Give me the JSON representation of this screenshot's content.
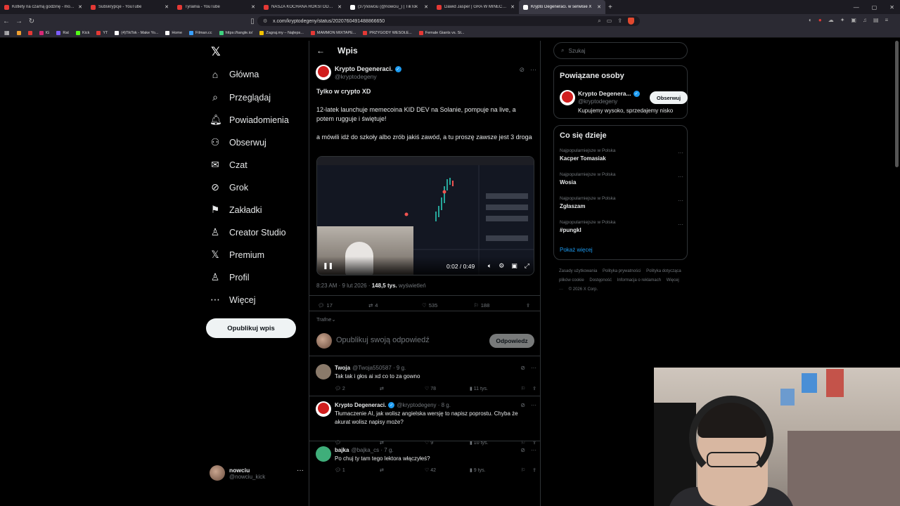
{
  "browser": {
    "tabs": [
      {
        "title": "Kotlety na czarną godzinę - mogą st...",
        "color": "#e53935"
      },
      {
        "title": "Subskrypcje - YouTube",
        "color": "#e53935"
      },
      {
        "title": "Tyrainia - YouTube",
        "color": "#e53935"
      },
      {
        "title": "NASZA KOCHANA ROKSI ODESZŁA",
        "color": "#e53935"
      },
      {
        "title": "(37)nowciu (@nowciu_) | TikTok",
        "color": "#ffffff"
      },
      {
        "title": "Dawid Jasper | GRA W MINECRAFT -",
        "color": "#e53935"
      },
      {
        "title": "Krypto Degeneraci. w serwisie X",
        "color": "#ffffff",
        "active": true
      }
    ],
    "new_tab": "+",
    "url": "x.com/kryptodegeny/status/2020760491488866650",
    "bookmarks": [
      {
        "label": "",
        "color": "#f0a030"
      },
      {
        "label": "",
        "color": "#e53935"
      },
      {
        "label": "IG",
        "color": "#d62976"
      },
      {
        "label": "Rat",
        "color": "#7c5cff"
      },
      {
        "label": "Kick",
        "color": "#53fc18"
      },
      {
        "label": "YT",
        "color": "#e53935"
      },
      {
        "label": "(4)TikTok - Make Yo...",
        "color": "#ffffff"
      },
      {
        "label": "Home",
        "color": "#ffffff"
      },
      {
        "label": "Filman.cc",
        "color": "#3aa0ff"
      },
      {
        "label": "https://tangle.io/",
        "color": "#3fd27f"
      },
      {
        "label": "Zagraj.my – Najleps...",
        "color": "#f2c200"
      },
      {
        "label": "MAMMON MIXTAPE...",
        "color": "#e53935"
      },
      {
        "label": "PRZYGODY WESOŁE...",
        "color": "#e53935"
      },
      {
        "label": "Female Giants vs. St...",
        "color": "#e53935"
      }
    ]
  },
  "nav": {
    "items": [
      {
        "label": "Główna",
        "icon": "⌂",
        "name": "home"
      },
      {
        "label": "Przeglądaj",
        "icon": "⌕",
        "name": "explore"
      },
      {
        "label": "Powiadomienia",
        "icon": "🔔︎",
        "name": "notifications"
      },
      {
        "label": "Obserwuj",
        "icon": "⚇",
        "name": "follow"
      },
      {
        "label": "Czat",
        "icon": "✉",
        "name": "chat"
      },
      {
        "label": "Grok",
        "icon": "⊘",
        "name": "grok"
      },
      {
        "label": "Zakładki",
        "icon": "⚑",
        "name": "bookmarks"
      },
      {
        "label": "Creator Studio",
        "icon": "♙",
        "name": "creator-studio"
      },
      {
        "label": "Premium",
        "icon": "𝕏",
        "name": "premium"
      },
      {
        "label": "Profil",
        "icon": "♙",
        "name": "profile"
      },
      {
        "label": "Więcej",
        "icon": "⋯",
        "name": "more"
      }
    ],
    "post_button": "Opublikuj wpis",
    "user": {
      "name": "nowciu",
      "handle": "@nowciu_kick"
    }
  },
  "post": {
    "header": "Wpis",
    "author": "Krypto Degeneraci.",
    "handle": "@kryptodegeny",
    "title": "Tylko w crypto XD",
    "para1": "12-latek launchuje memecoina KID DEV na Solanie, pompuje na live, a potem rugguje i świętuje!",
    "para2": "a mówili idź do szkoły albo zrób jakiś zawód, a tu proszę zawsze jest 3 droga",
    "video_time": "0:02 / 0:49",
    "video_progress": 0.04,
    "timestamp": "8:23 AM · 9 lut 2026 · ",
    "views": "148,5 tys.",
    "views_label": " wyświetleń",
    "replies": "17",
    "reposts": "4",
    "likes": "535",
    "bookmarks": "188",
    "sort": "Trafne",
    "reply_placeholder": "Opublikuj swoją odpowiedź",
    "reply_button": "Odpowiedz"
  },
  "replies": [
    {
      "name": "Twoja",
      "handle": "@Twoja550587 · 9 g.",
      "text": "Tak tak i głos ai xd co to za gowno",
      "replies": "2",
      "reposts": "",
      "likes": "78",
      "views": "11 tys.",
      "avatar": "#8a7a6a",
      "verified": false
    },
    {
      "name": "Krypto Degeneraci.",
      "handle": "@kryptodegeny · 8 g.",
      "text": "Tłumaczenie AI,  jak wolisz angielska wersję to napisz poprostu.  Chyba że akurat wolisz napisy może?",
      "replies": "",
      "reposts": "",
      "likes": "9",
      "views": "10 tys.",
      "avatar": "#d11e1e",
      "verified": true
    },
    {
      "name": "bajka",
      "handle": "@bajka_cs · 7 g.",
      "text": "Po chuj ty tam tego lektora włączyłeś?",
      "replies": "1",
      "reposts": "",
      "likes": "42",
      "views": "9 tys.",
      "avatar": "#3fae7a",
      "verified": false
    }
  ],
  "sidebar": {
    "search_placeholder": "Szukaj",
    "people_title": "Powiązane osoby",
    "person": {
      "name": "Krypto Degenera...",
      "handle": "@kryptodegeny",
      "bio": "Kupujemy wysoko, sprzedajemy nisko",
      "follow": "Obserwuj"
    },
    "trends_title": "Co się dzieje",
    "trends": [
      {
        "context": "Najpopularniejsze w Polska",
        "name": "Kacper Tomasiak"
      },
      {
        "context": "Najpopularniejsze w Polska",
        "name": "Wosia"
      },
      {
        "context": "Najpopularniejsze w Polska",
        "name": "Zgłaszam"
      },
      {
        "context": "Najpopularniejsze w Polska",
        "name": "#pungkl"
      }
    ],
    "show_more": "Pokaż więcej",
    "footer": [
      "Zasady użytkowania",
      "Polityka prywatności",
      "Polityka dotycząca plików cookie",
      "Dostępność",
      "Informacja o reklamach",
      "Więcej ···",
      "© 2026 X Corp."
    ]
  }
}
